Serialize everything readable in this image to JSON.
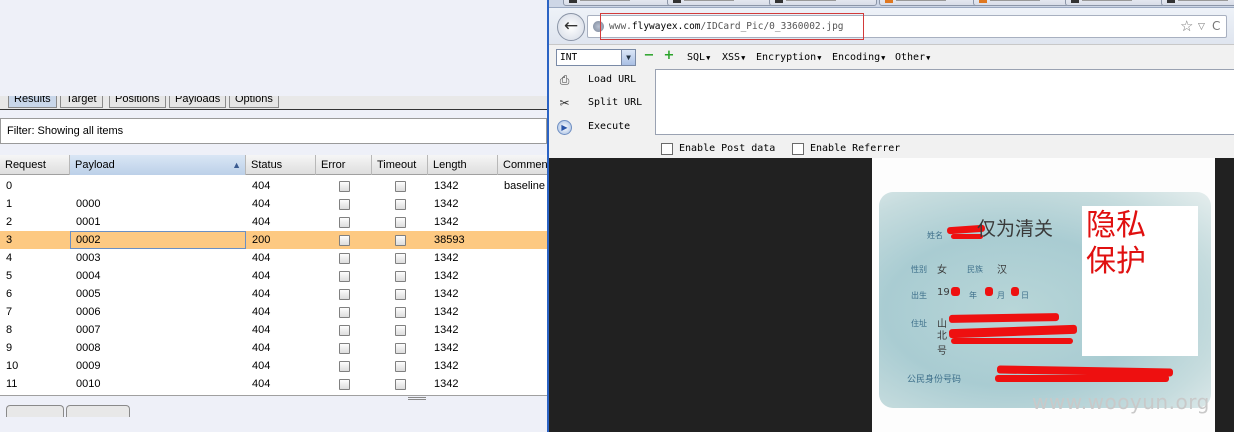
{
  "burp": {
    "tabs": [
      "Results",
      "Target",
      "Positions",
      "Payloads",
      "Options"
    ],
    "filter_text": "Filter:  Showing all items",
    "columns": [
      "Request",
      "Payload",
      "Status",
      "Error",
      "Timeout",
      "Length",
      "Comment"
    ],
    "sorted_column": "Payload",
    "sort_direction": "ascending",
    "selected_row": 3,
    "rows": [
      {
        "request": "0",
        "payload": "",
        "status": "404",
        "length": "1342",
        "comment": "baseline"
      },
      {
        "request": "1",
        "payload": "0000",
        "status": "404",
        "length": "1342",
        "comment": ""
      },
      {
        "request": "2",
        "payload": "0001",
        "status": "404",
        "length": "1342",
        "comment": ""
      },
      {
        "request": "3",
        "payload": "0002",
        "status": "200",
        "length": "38593",
        "comment": ""
      },
      {
        "request": "4",
        "payload": "0003",
        "status": "404",
        "length": "1342",
        "comment": ""
      },
      {
        "request": "5",
        "payload": "0004",
        "status": "404",
        "length": "1342",
        "comment": ""
      },
      {
        "request": "6",
        "payload": "0005",
        "status": "404",
        "length": "1342",
        "comment": ""
      },
      {
        "request": "7",
        "payload": "0006",
        "status": "404",
        "length": "1342",
        "comment": ""
      },
      {
        "request": "8",
        "payload": "0007",
        "status": "404",
        "length": "1342",
        "comment": ""
      },
      {
        "request": "9",
        "payload": "0008",
        "status": "404",
        "length": "1342",
        "comment": ""
      },
      {
        "request": "10",
        "payload": "0009",
        "status": "404",
        "length": "1342",
        "comment": ""
      },
      {
        "request": "11",
        "payload": "0010",
        "status": "404",
        "length": "1342",
        "comment": ""
      }
    ]
  },
  "firefox": {
    "url_prefix": "www.",
    "url_domain": "flywayex.com",
    "url_path": "/IDCard_Pic/0_3360002.jpg",
    "icons": {
      "back": "back-arrow-icon",
      "bookmark": "star-icon",
      "dropdown": "dropdown-arrow-icon",
      "reload": "refresh-icon"
    },
    "highlight_color": "#d23a3a"
  },
  "hackbar": {
    "select_value": "INT",
    "menus": [
      "SQL",
      "XSS",
      "Encryption",
      "Encoding",
      "Other"
    ],
    "actions": [
      {
        "label": "Load URL",
        "icon": "load-url-icon"
      },
      {
        "label": "Split URL",
        "icon": "scissors-icon"
      },
      {
        "label": "Execute",
        "icon": "play-icon"
      }
    ],
    "enable_post_label": "Enable Post data",
    "enable_referrer_label": "Enable Referrer"
  },
  "idcard": {
    "header_visible": "仅为清关",
    "label_name": "姓名",
    "label_gender": "性别",
    "gender": "女",
    "label_ethnicity": "民族",
    "ethnicity": "汉",
    "label_birth": "出生",
    "birth_year_partial": "19",
    "label_year": "年",
    "label_month": "月",
    "label_day": "日",
    "label_address": "住址",
    "address_start": "山",
    "address_line2_start": "北",
    "address_line3": "号",
    "label_id": "公民身份号码",
    "privacy_overlay": "隐私保护",
    "redaction_color": "#ee1010"
  },
  "watermark": "www.wooyun.org"
}
